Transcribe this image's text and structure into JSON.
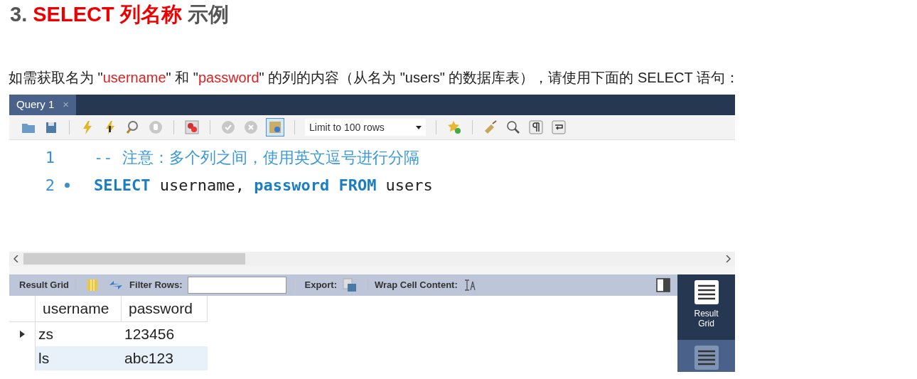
{
  "heading": {
    "segments": [
      {
        "text": "3. ",
        "highlight": false
      },
      {
        "text": "SELECT 列名称 ",
        "highlight": true
      },
      {
        "text": "示例",
        "highlight": false
      }
    ]
  },
  "intro": {
    "segments": [
      {
        "text": "如需获取名为 \"",
        "highlight": false
      },
      {
        "text": "username",
        "highlight": true
      },
      {
        "text": "\" 和 \"",
        "highlight": false
      },
      {
        "text": "password",
        "highlight": true
      },
      {
        "text": "\" 的列的内容（从名为 \"users\" 的数据库表），请使用下面的 SELECT 语句：",
        "highlight": false
      }
    ]
  },
  "workbench": {
    "tabs": [
      {
        "label": "Query 1",
        "close": "×",
        "selected": true
      }
    ],
    "toolbar": {
      "limit_select": "Limit to 100 rows",
      "toggle_on": true
    },
    "editor": {
      "lines": [
        {
          "number": "1",
          "current": false,
          "tokens": [
            {
              "kind": "comment",
              "text": "-- 注意：多个列之间，使用英文逗号进行分隔"
            }
          ]
        },
        {
          "number": "2",
          "current": true,
          "tokens": [
            {
              "kind": "keyword",
              "text": "SELECT"
            },
            {
              "kind": "plain",
              "text": " username, "
            },
            {
              "kind": "keyword",
              "text": "password FROM"
            },
            {
              "kind": "plain",
              "text": " users"
            }
          ]
        }
      ]
    },
    "result_toolbar": {
      "result_grid": "Result Grid",
      "filter_label": "Filter Rows:",
      "export_label": "Export:",
      "wrap_label": "Wrap Cell Content:"
    },
    "grid": {
      "columns": [
        "username",
        "password"
      ],
      "rows": [
        {
          "selected": true,
          "cells": [
            "zs",
            "123456"
          ]
        },
        {
          "selected": false,
          "cells": [
            "ls",
            "abc123"
          ]
        }
      ]
    },
    "side_tabs": [
      {
        "label": "Result Grid",
        "selected": true
      },
      {
        "selected": false
      }
    ]
  }
}
